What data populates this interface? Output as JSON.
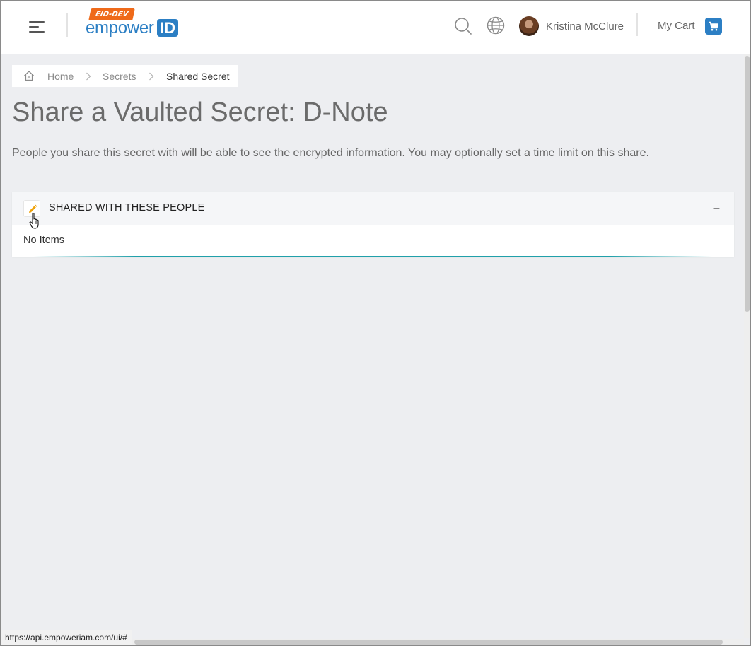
{
  "header": {
    "logo": {
      "badge": "EID-DEV",
      "word": "empower",
      "id": "ID"
    },
    "user": {
      "name": "Kristina McClure"
    },
    "cart": {
      "label": "My Cart"
    }
  },
  "breadcrumb": {
    "items": [
      {
        "label": "Home"
      },
      {
        "label": "Secrets"
      },
      {
        "label": "Shared Secret"
      }
    ]
  },
  "page": {
    "title": "Share a Vaulted Secret: D-Note",
    "description": "People you share this secret with will be able to see the encrypted information. You may optionally set a time limit on this share."
  },
  "panel": {
    "title": "SHARED WITH THESE PEOPLE",
    "collapse_symbol": "–",
    "empty_text": "No Items"
  },
  "status_bar": {
    "url": "https://api.empoweriam.com/ui/#"
  },
  "colors": {
    "brand_blue": "#2c7fc4",
    "badge_orange": "#ef6a1a",
    "edit_icon": "#f0a30a",
    "accent_teal": "#20a0aa"
  }
}
